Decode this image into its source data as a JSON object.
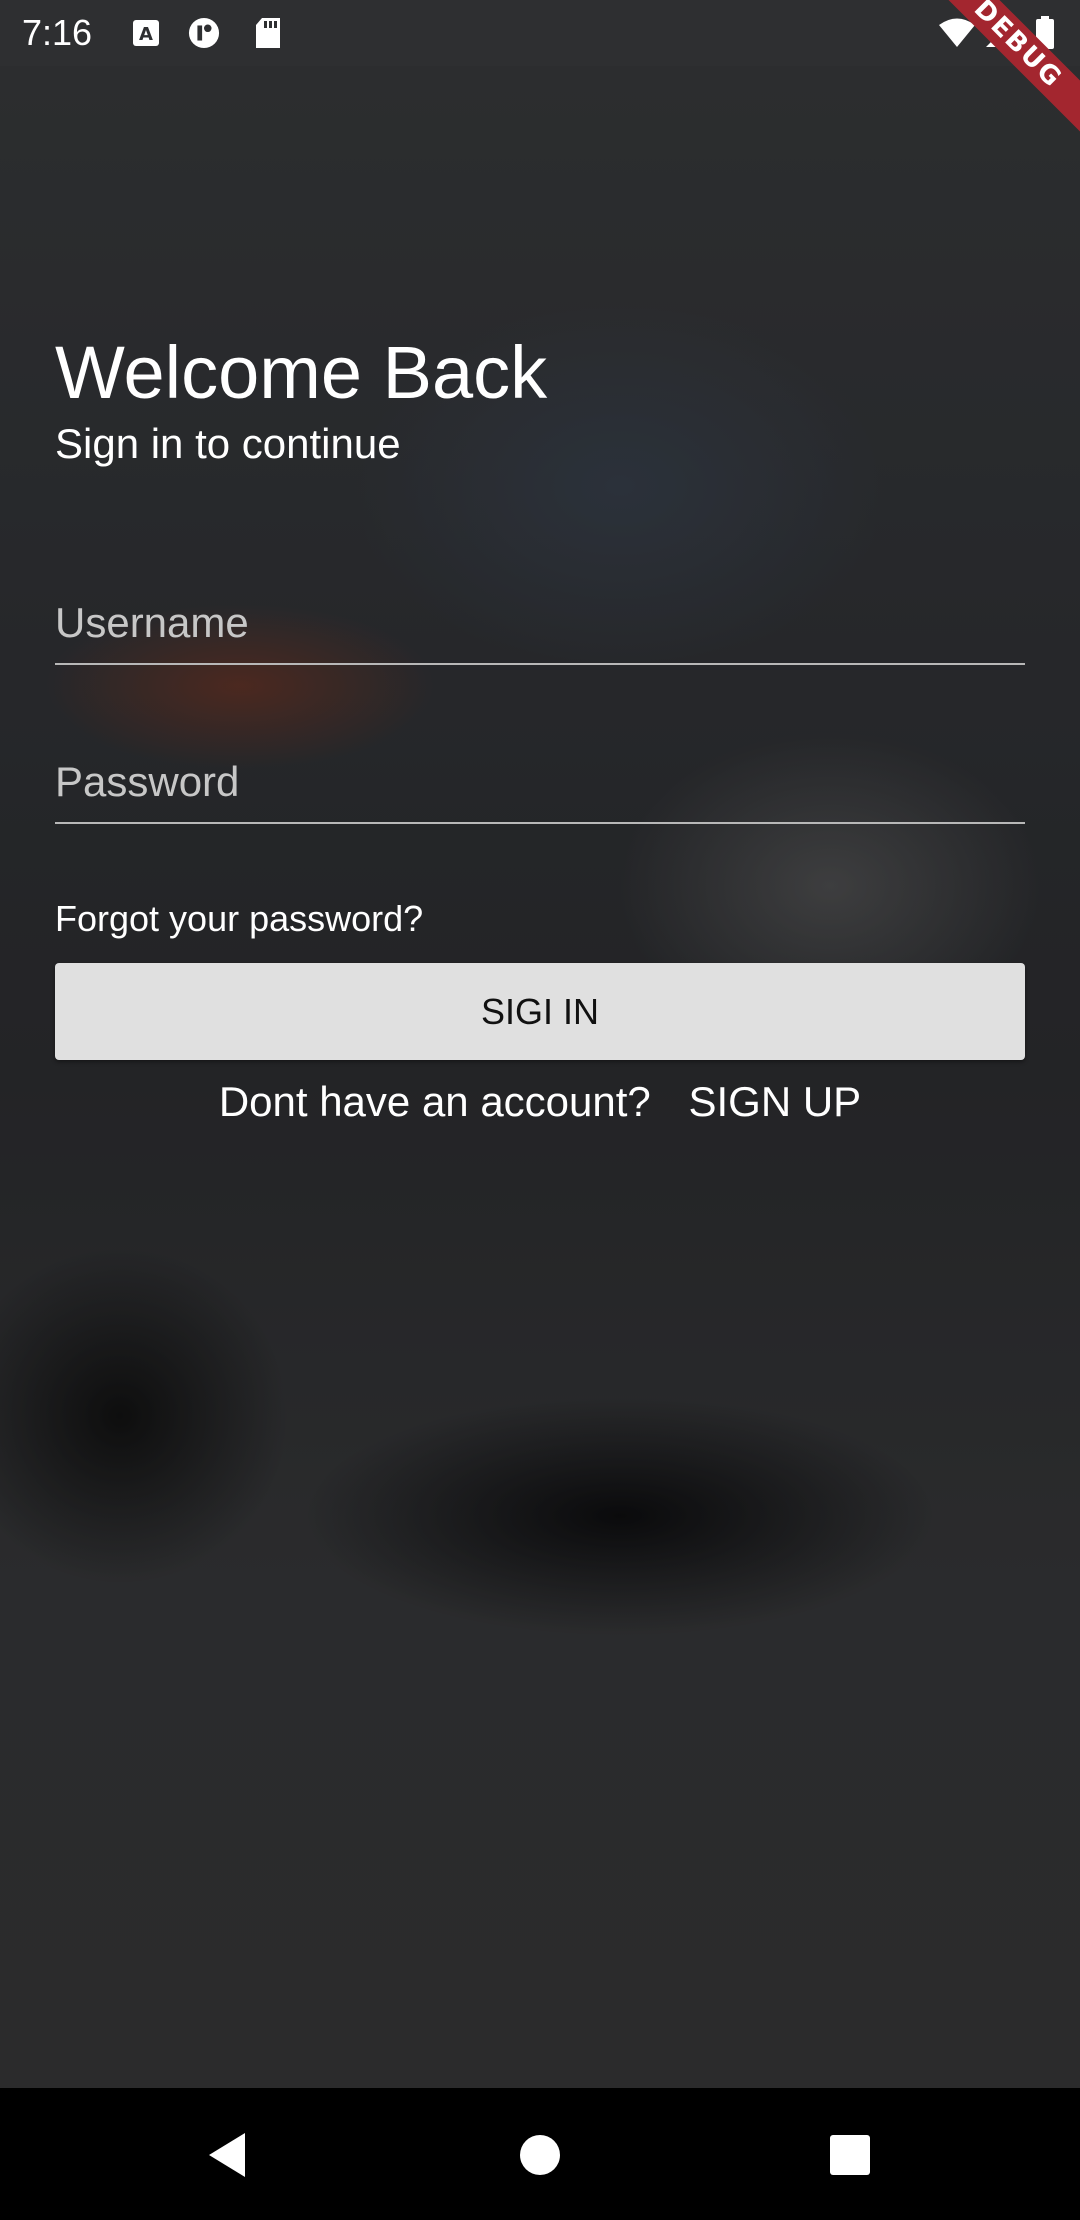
{
  "status_bar": {
    "time": "7:16",
    "icons": [
      "a-text-icon",
      "vpn-icon",
      "sd-card-icon",
      "wifi-icon",
      "signal-icon",
      "battery-icon"
    ]
  },
  "debug_banner": "DEBUG",
  "login": {
    "title": "Welcome Back",
    "subtitle": "Sign in to continue",
    "username_placeholder": "Username",
    "password_placeholder": "Password",
    "forgot_password": "Forgot your password?",
    "signin_label": "SIGI IN",
    "no_account_text": "Dont have an account?",
    "signup_label": "SIGN UP"
  },
  "nav": {
    "back": "back-icon",
    "home": "home-icon",
    "recents": "recents-icon"
  },
  "colors": {
    "status_bar_bg": "#2e2f31",
    "button_bg": "#e0e0e0",
    "debug_banner": "#a3262f",
    "text": "#ffffff"
  }
}
